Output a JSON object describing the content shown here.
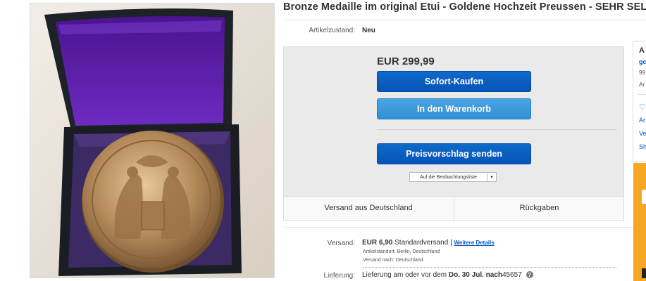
{
  "listing": {
    "title": "Bronze Medaille im original Etui - Goldene Hochzeit Preussen - SEHR SELTEN"
  },
  "condition": {
    "label": "Artikelzustand:",
    "value": "Neu"
  },
  "buy_box": {
    "price": "EUR 299,99",
    "buy_now_label": "Sofort-Kaufen",
    "add_to_cart_label": "In den Warenkorb",
    "make_offer_label": "Preisvorschlag senden",
    "watchlist_label": "Auf die Beobachtungsliste",
    "ships_from": "Versand aus Deutschland",
    "returns": "Rückgaben"
  },
  "shipping": {
    "label": "Versand:",
    "cost": "EUR 6,90",
    "method": "Standardversand |",
    "details_link": "Weitere Details",
    "location_label": "Artikelstandort:",
    "location": "Berlin, Deutschland",
    "ships_to_label": "Versand nach:",
    "ships_to": "Deutschland"
  },
  "delivery": {
    "label": "Lieferung:",
    "prefix": "Lieferung am oder vor dem",
    "date": "Do. 30 Jul.",
    "to_label": "nach",
    "postcode": "45657"
  },
  "seller": {
    "heading": "A",
    "name": "gc",
    "score": "99",
    "line3": "Ar",
    "line4": "Ar",
    "line5": "Ve",
    "line6": "Sh"
  },
  "colors": {
    "primary_button": "#0654ba",
    "secondary_button": "#3191d6",
    "link": "#0654ba",
    "promo": "#f5a623",
    "box_velvet": "#5a1aa0"
  },
  "icons": [
    "heart-icon",
    "help-icon",
    "chevron-down-icon"
  ]
}
